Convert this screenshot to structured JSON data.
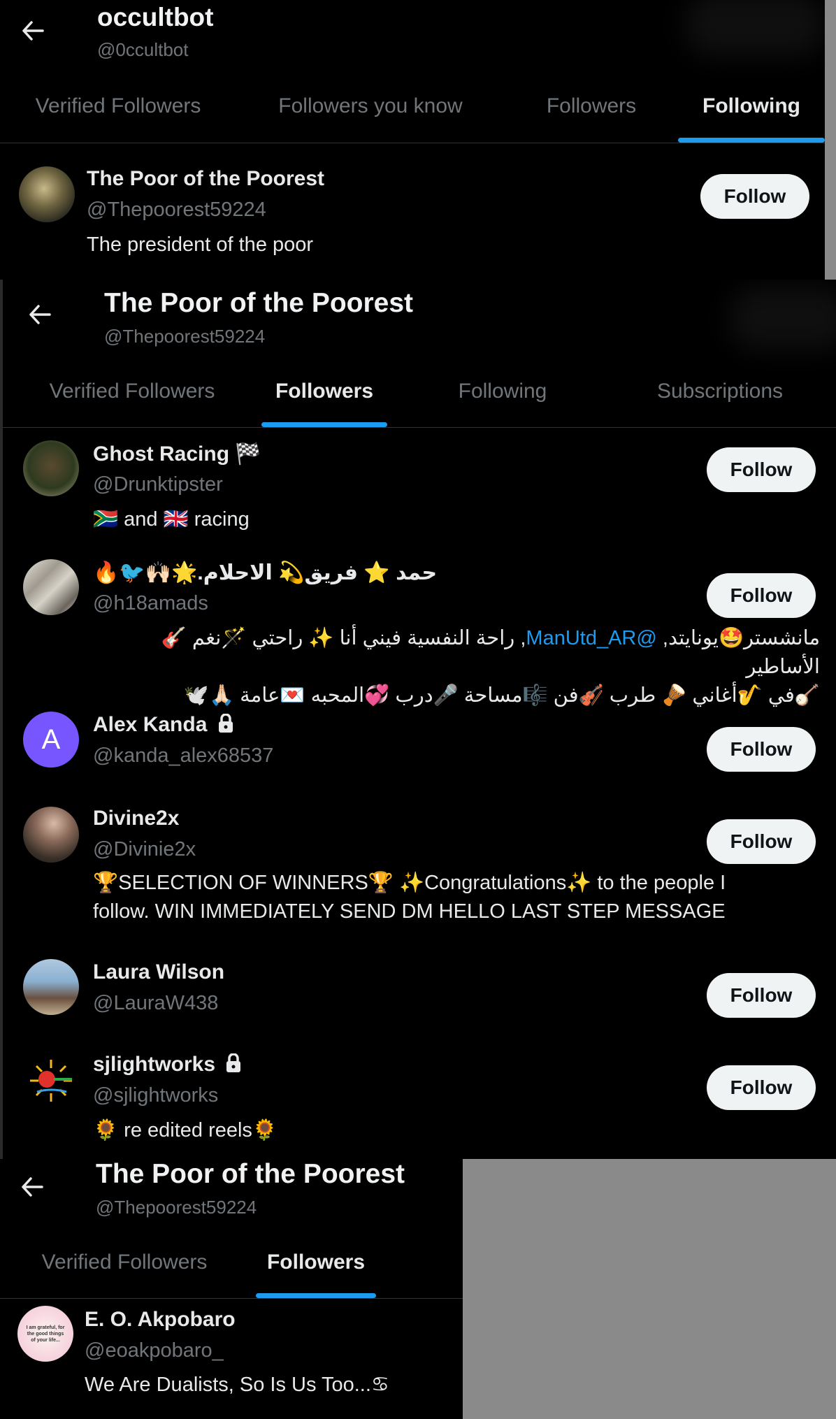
{
  "panel1": {
    "title": "occultbot",
    "handle": "@0ccultbot",
    "tabs": [
      "Verified Followers",
      "Followers you know",
      "Followers",
      "Following"
    ],
    "active_tab": 3,
    "users": [
      {
        "name": "The Poor of the Poorest",
        "handle": "@Thepoorest59224",
        "bio": "The president of the poor",
        "follow_label": "Follow"
      }
    ]
  },
  "panel2": {
    "title": "The Poor of the Poorest",
    "handle": "@Thepoorest59224",
    "tabs": [
      "Verified Followers",
      "Followers",
      "Following",
      "Subscriptions"
    ],
    "active_tab": 1,
    "users": [
      {
        "name": "Ghost Racing 🏁",
        "handle": "@Drunktipster",
        "bio": "🇿🇦 and 🇬🇧 racing",
        "follow_label": "Follow"
      },
      {
        "name": "🔥🐦🙌🏻🌟.حمد ⭐ فريق💫 الاحلام",
        "handle": "@h18amads",
        "bio_line1_pre": "مانشستر🤩يونايتد, ",
        "bio_mention": "@ManUtd_AR",
        "bio_line1_post": ", راحة النفسية فيني أنا ✨ راحتي 🪄نغم 🎸الأساطير",
        "bio_line2": "🪕في 🎷أغاني 🪘 طرب 🎻فن 🎼مساحة 🎤درب 💞المحبه 💌عامة 🙏🏻🕊️",
        "follow_label": "Follow"
      },
      {
        "name": "Alex Kanda",
        "handle": "@kanda_alex68537",
        "avatar_letter": "A",
        "follow_label": "Follow"
      },
      {
        "name": "Divine2x",
        "handle": "@Divinie2x",
        "bio": "🏆SELECTION OF WINNERS🏆 ✨Congratulations✨ to the people I follow. WIN IMMEDIATELY SEND DM HELLO LAST STEP MESSAGE",
        "follow_label": "Follow"
      },
      {
        "name": "Laura Wilson",
        "handle": "@LauraW438",
        "follow_label": "Follow"
      },
      {
        "name": "sjlightworks",
        "handle": "@sjlightworks",
        "bio": "🌻 re edited reels🌻",
        "follow_label": "Follow"
      }
    ]
  },
  "panel3": {
    "title": "The Poor of the Poorest",
    "handle": "@Thepoorest59224",
    "tabs": [
      "Verified Followers",
      "Followers"
    ],
    "active_tab": 1,
    "users": [
      {
        "name": "E. O. Akpobaro",
        "handle": "@eoakpobaro_",
        "bio": "We Are Dualists, So Is Us Too...♋",
        "avatar_text": "I am grateful, for the good things of your life..."
      }
    ]
  },
  "colors": {
    "accent": "#1d9bf0",
    "background": "#000000",
    "muted": "#71767b",
    "avatar_purple": "#7856ff"
  },
  "icons": {
    "back": "arrow-left-icon",
    "lock": "lock-icon"
  }
}
